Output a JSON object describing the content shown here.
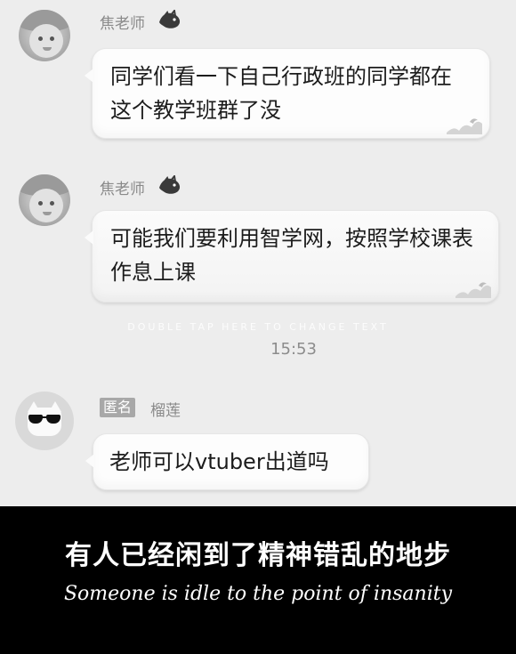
{
  "messages": [
    {
      "sender": "焦老师",
      "badge_icon": "dragon-badge-icon",
      "avatar_icon": "child-avatar-icon",
      "text": "同学们看一下自己行政班的同学都在这个教学班群了没"
    },
    {
      "sender": "焦老师",
      "badge_icon": "dragon-badge-icon",
      "avatar_icon": "child-avatar-icon",
      "text": "可能我们要利用智学网，按照学校课表作息上课"
    },
    {
      "sender": "榴莲",
      "anonymous_tag": "匿名",
      "avatar_icon": "cat-sunglasses-avatar-icon",
      "text": "老师可以vtuber出道吗"
    }
  ],
  "overlay_hint": "DOUBLE TAP HERE TO CHANGE TEXT",
  "timestamp": "15:53",
  "caption": {
    "chinese": "有人已经闲到了精神错乱的地步",
    "english": "Someone is idle to the point of insanity"
  }
}
